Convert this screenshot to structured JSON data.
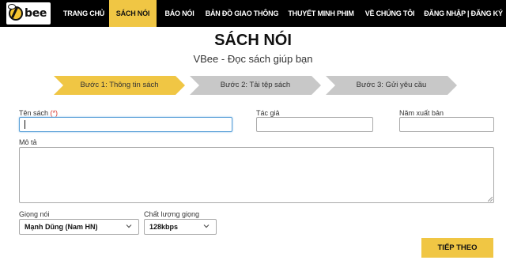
{
  "brand": {
    "logo_text": "bee"
  },
  "nav": {
    "items": [
      {
        "label": "TRANG CHỦ",
        "active": false
      },
      {
        "label": "SÁCH NÓI",
        "active": true
      },
      {
        "label": "BÁO NÓI",
        "active": false
      },
      {
        "label": "BẢN ĐỒ GIAO THÔNG",
        "active": false
      },
      {
        "label": "THUYẾT MINH PHIM",
        "active": false
      },
      {
        "label": "VỀ CHÚNG TÔI",
        "active": false
      },
      {
        "label": "ĐĂNG NHẬP | ĐĂNG KÝ",
        "active": false
      }
    ]
  },
  "page": {
    "title": "SÁCH NÓI",
    "subtitle": "VBee - Đọc sách giúp bạn"
  },
  "steps": [
    {
      "label": "Bước 1: Thông tin sách",
      "active": true
    },
    {
      "label": "Bước 2: Tải tệp sách",
      "active": false
    },
    {
      "label": "Bước 3: Gửi yêu cầu",
      "active": false
    }
  ],
  "form": {
    "book_name_label": "Tên sách",
    "required_mark": "(*)",
    "book_name_value": "",
    "author_label": "Tác giả",
    "author_value": "",
    "year_label": "Năm xuất bản",
    "year_value": "",
    "description_label": "Mô tả",
    "description_value": "",
    "voice_label": "Giọng nói",
    "voice_value": "Mạnh Dũng (Nam HN)",
    "quality_label": "Chất lượng giọng",
    "quality_value": "128kbps",
    "next_button": "TIẾP THEO"
  },
  "colors": {
    "accent": "#f0c644",
    "nav_background": "#000000",
    "step_inactive": "#c8c8c8",
    "required": "#d9342b",
    "focus_border": "#5aa0d8"
  }
}
